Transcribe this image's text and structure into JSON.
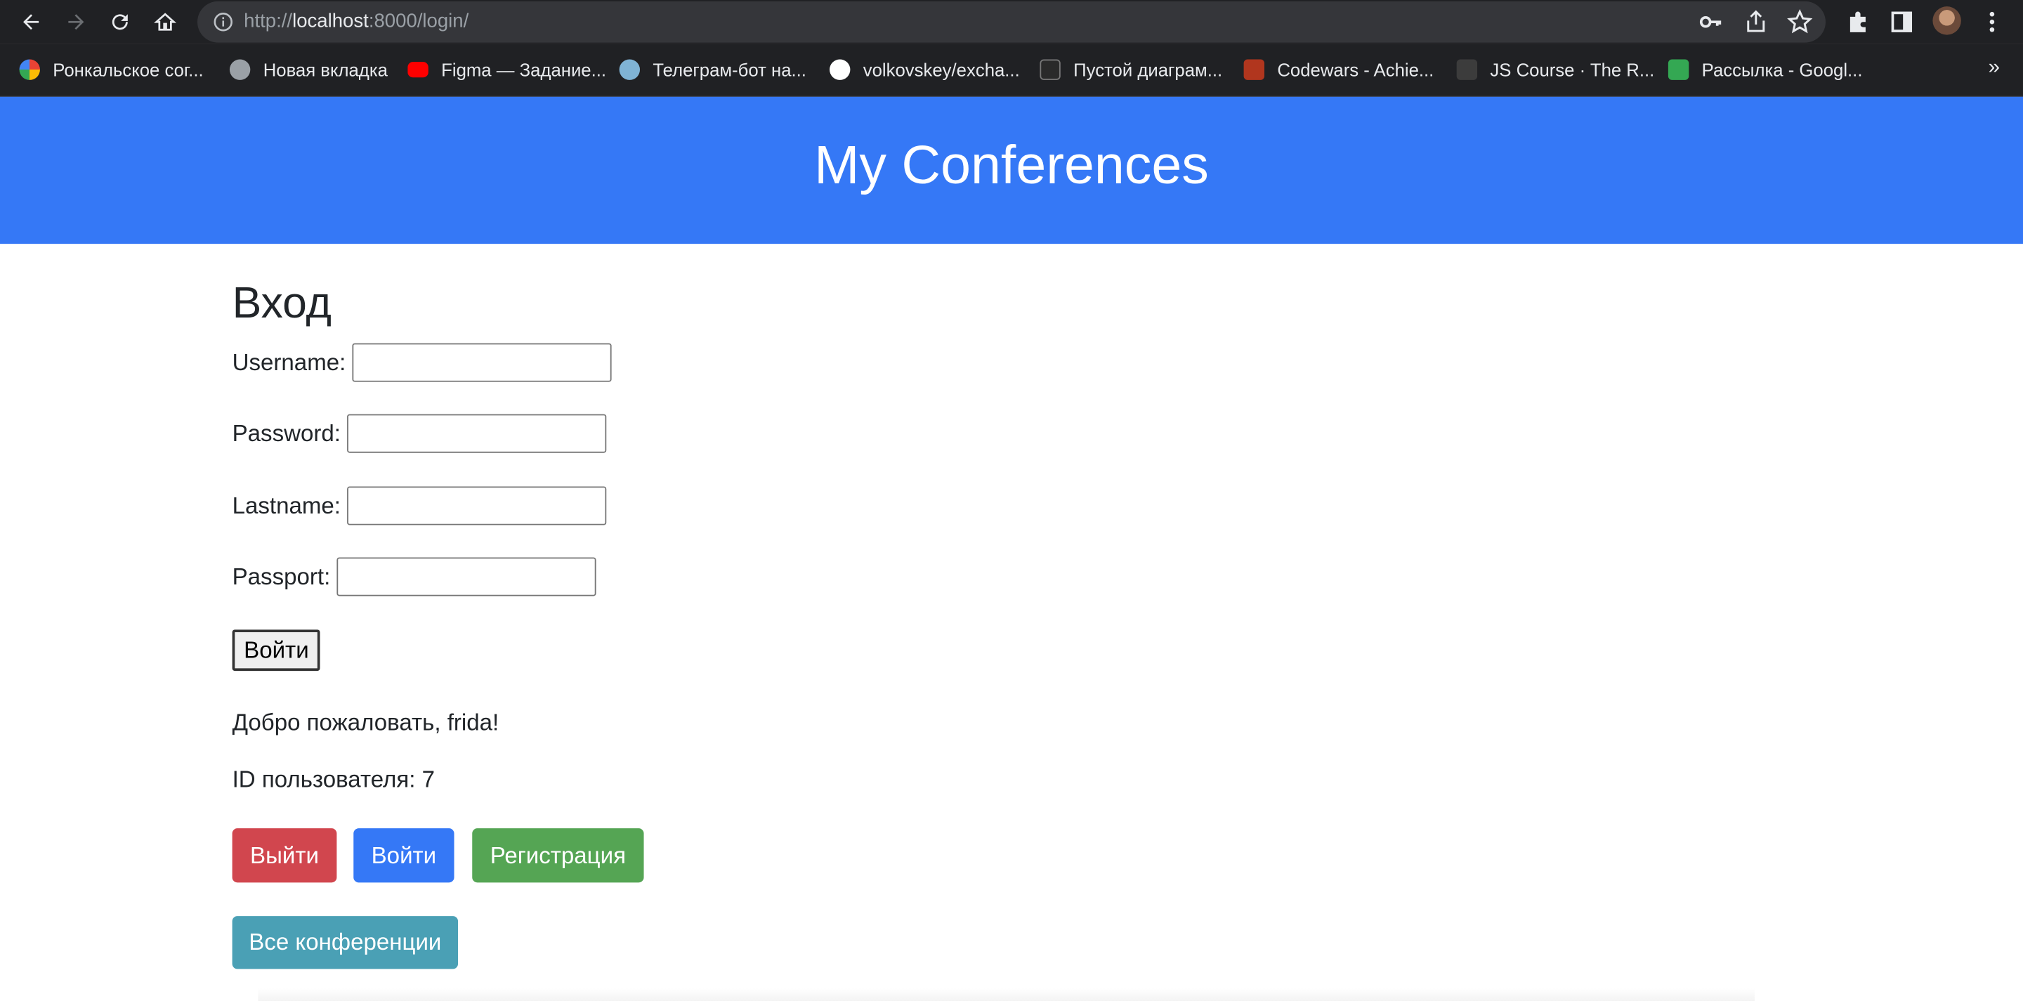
{
  "browser": {
    "url_prefix": "http://",
    "url_host": "localhost",
    "url_rest": ":8000/login/",
    "bookmarks": [
      {
        "label": "Ронкальское сог...",
        "icon": "google-icon",
        "color": "#ffffff"
      },
      {
        "label": "Новая вкладка",
        "icon": "globe-icon",
        "color": "#9aa0a6"
      },
      {
        "label": "Figma — Задание...",
        "icon": "youtube-icon",
        "color": "#ff0000"
      },
      {
        "label": "Телеграм-бот на...",
        "icon": "image-icon",
        "color": "#7fb3d5"
      },
      {
        "label": "volkovskey/excha...",
        "icon": "github-icon",
        "color": "#ffffff"
      },
      {
        "label": "Пустой диаграм...",
        "icon": "lucid-icon",
        "color": "#ffffff"
      },
      {
        "label": "Codewars - Achie...",
        "icon": "codewars-icon",
        "color": "#b1361e"
      },
      {
        "label": "JS Course · The R...",
        "icon": "page-icon",
        "color": "#3c3c3c"
      },
      {
        "label": "Рассылка - Googl...",
        "icon": "sheets-icon",
        "color": "#34a853"
      }
    ],
    "more": "»"
  },
  "header": {
    "title": "My Conferences"
  },
  "form": {
    "heading": "Вход",
    "fields": [
      {
        "label": "Username:",
        "value": ""
      },
      {
        "label": "Password:",
        "value": ""
      },
      {
        "label": "Lastname:",
        "value": ""
      },
      {
        "label": "Passport:",
        "value": ""
      }
    ],
    "submit_label": "Войти"
  },
  "status": {
    "welcome": "Добро пожаловать, frida!",
    "user_id": "ID пользователя: 7"
  },
  "actions": {
    "logout": "Выйти",
    "login": "Войти",
    "register": "Регистрация",
    "all_conferences": "Все конференции"
  },
  "colors": {
    "header_bg": "#3578f6",
    "danger": "#d1464e",
    "primary": "#3578f6",
    "success": "#55a554",
    "info": "#4aa0b5"
  }
}
